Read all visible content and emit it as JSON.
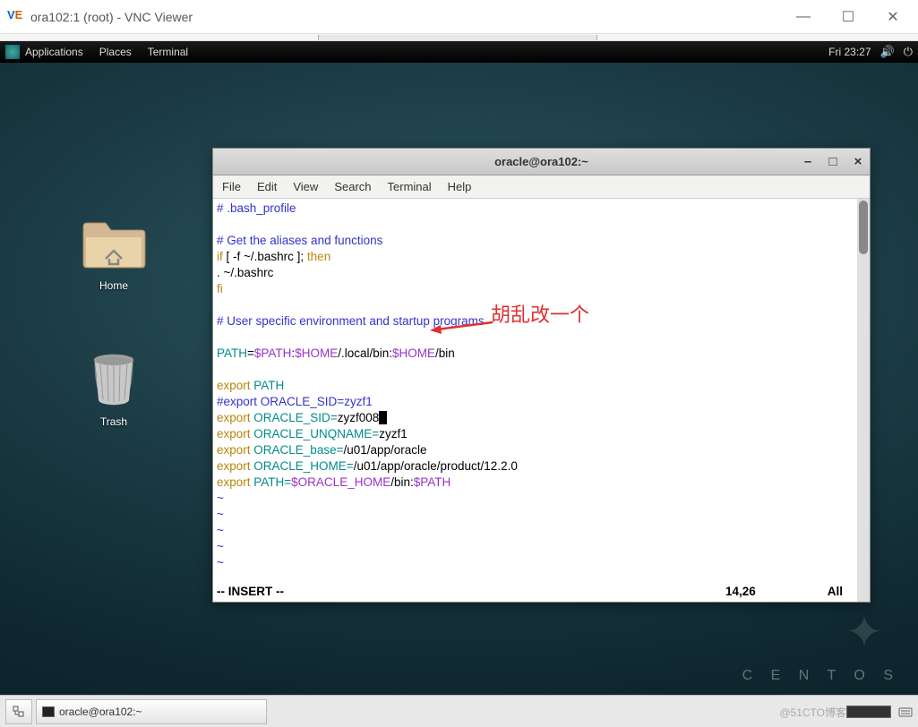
{
  "vnc": {
    "title": "ora102:1 (root) - VNC Viewer"
  },
  "gnome": {
    "menu": [
      "Applications",
      "Places",
      "Terminal"
    ],
    "clock": "Fri 23:27"
  },
  "desktop": {
    "home_label": "Home",
    "trash_label": "Trash",
    "centos": "C E N T O S"
  },
  "terminal": {
    "title": "oracle@ora102:~",
    "menus": [
      "File",
      "Edit",
      "View",
      "Search",
      "Terminal",
      "Help"
    ],
    "lines": {
      "l1": "# .bash_profile",
      "l2": "# Get the aliases and functions",
      "l3_if": "if",
      "l3_rest": " [ -f ~/.bashrc ]; ",
      "l3_then": "then",
      "l4": "      . ~/.bashrc",
      "l5_fi": "fi",
      "l6": "# User specific environment and startup programs",
      "l7_path": "PATH",
      "l7_eq": "=",
      "l7_v1": "$PATH",
      "l7_c1": ":",
      "l7_v2": "$HOME",
      "l7_mid": "/.local/bin:",
      "l7_v3": "$HOME",
      "l7_end": "/bin",
      "l8_exp": "export",
      "l8_path": " PATH",
      "l9": "#export ORACLE_SID=zyzf1",
      "l10_exp": "export",
      "l10_var": " ORACLE_SID=",
      "l10_val": "zyzf008",
      "l11_exp": "export",
      "l11_var": " ORACLE_UNQNAME=",
      "l11_val": "zyzf1",
      "l12_exp": "export",
      "l12_var": " ORACLE_base=",
      "l12_val": "/u01/app/oracle",
      "l13_exp": "export",
      "l13_var": " ORACLE_HOME=",
      "l13_val": "/u01/app/oracle/product/12.2.0",
      "l14_exp": "export",
      "l14_var": " PATH=",
      "l14_v1": "$ORACLE_HOME",
      "l14_mid": "/bin:",
      "l14_v2": "$PATH",
      "tilde": "~"
    },
    "vim": {
      "mode": "-- INSERT --",
      "pos": "14,26",
      "all": "All"
    }
  },
  "annotation": {
    "text": "胡乱改一个"
  },
  "taskbar": {
    "task1": "oracle@ora102:~",
    "watermark": "@51CTO博客"
  }
}
